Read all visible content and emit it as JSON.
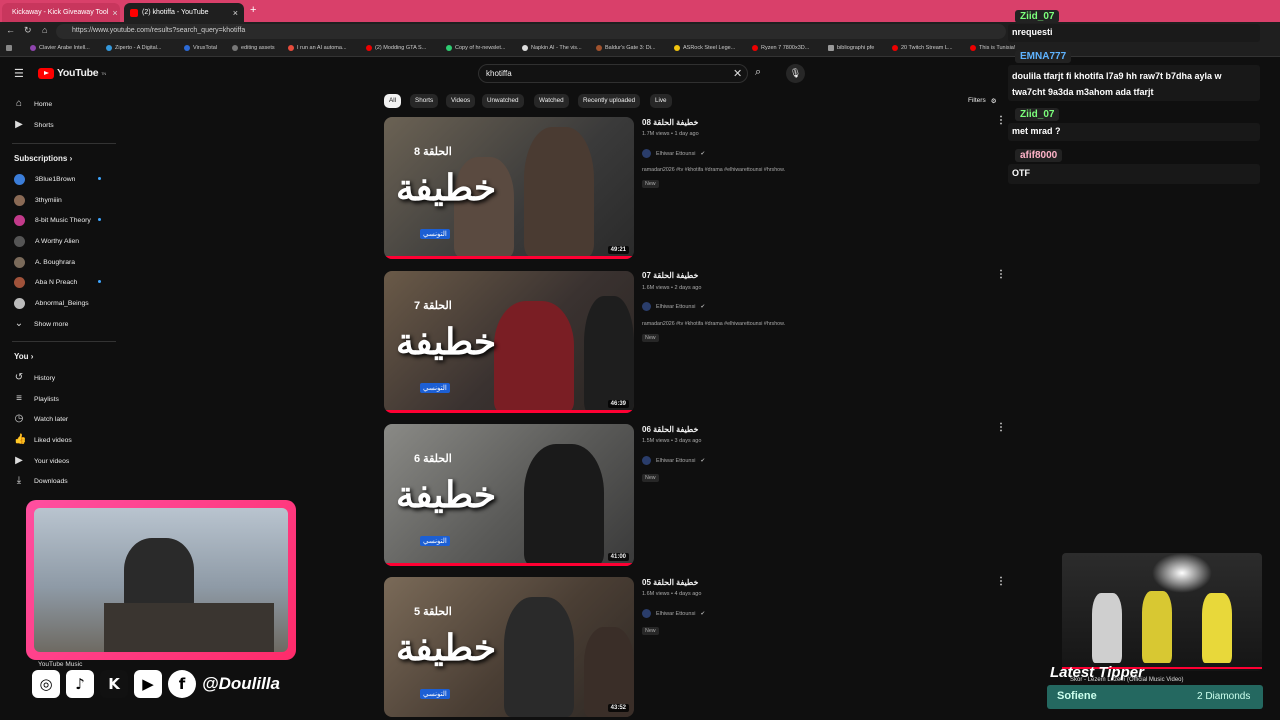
{
  "browser": {
    "tabs": [
      {
        "title": "Kickaway - Kick Giveaway Tool",
        "color": "#2ecc40"
      },
      {
        "title": "(2) khotiffa - YouTube",
        "color": "#ff0000"
      }
    ],
    "url": "https://www.youtube.com/results?search_query=khotiffa",
    "bookmarks": [
      "Clavier Arabe Intell...",
      "Ziperto - A Digital...",
      "VirusTotal",
      "editing assets",
      "I run an AI automa...",
      "(2) Modding GTA S...",
      "Copy of hr-newslet...",
      "Napkin AI - The vis...",
      "Baldur's Gate 3: Di...",
      "ASRock Steel Lege...",
      "Ryzen 7 7800x3D...",
      "bibliographi pfe",
      "20 Twitch Stream L...",
      "This is Tunisia!"
    ]
  },
  "youtube": {
    "logo_text": "YouTube",
    "logo_sup": "TN",
    "search_query": "khotiffa",
    "sidebar": {
      "top": [
        {
          "label": "Home",
          "icon": "home-icon"
        },
        {
          "label": "Shorts",
          "icon": "shorts-icon"
        }
      ],
      "subscriptions_title": "Subscriptions",
      "subscriptions": [
        {
          "label": "3Blue1Brown",
          "color": "#3b7dd8",
          "live": true
        },
        {
          "label": "3thymiiin",
          "color": "#8a6a55",
          "live": false
        },
        {
          "label": "8-bit Music Theory",
          "color": "#c23a8a",
          "live": true
        },
        {
          "label": "A Worthy Alien",
          "color": "#555",
          "live": false
        },
        {
          "label": "A. Boughrara",
          "color": "#7a6a5a",
          "live": false
        },
        {
          "label": "Aba N Preach",
          "color": "#a0523a",
          "live": true
        },
        {
          "label": "Abnormal_Beings",
          "color": "#bbbbbb",
          "live": false
        }
      ],
      "show_more": "Show more",
      "you_title": "You",
      "you": [
        {
          "label": "History",
          "icon": "history-icon"
        },
        {
          "label": "Playlists",
          "icon": "playlists-icon"
        },
        {
          "label": "Watch later",
          "icon": "watch-later-icon"
        },
        {
          "label": "Liked videos",
          "icon": "like-icon"
        },
        {
          "label": "Your videos",
          "icon": "your-videos-icon"
        },
        {
          "label": "Downloads",
          "icon": "download-icon"
        }
      ],
      "youtube_music": "YouTube Music"
    },
    "chips": [
      "All",
      "Shorts",
      "Videos",
      "Unwatched",
      "Watched",
      "Recently uploaded",
      "Live"
    ],
    "filters": "Filters",
    "results": [
      {
        "title": "خطيفة الحلقة 08",
        "views": "1.7M views",
        "age": "1 day ago",
        "channel": "Elhiwar Ettounsi",
        "desc": "ramadan2026 #tv #khotifa #drama #elhiwarettounsi #hrshow.",
        "badge": "New",
        "duration": "49:21",
        "ep_label": "الحلقة 8",
        "logo": "خطيفة",
        "tag": "التونسي"
      },
      {
        "title": "خطيفة الحلقة 07",
        "views": "1.6M views",
        "age": "2 days ago",
        "channel": "Elhiwar Ettounsi",
        "desc": "ramadan2026 #tv #khotifa #drama #elhiwarettounsi #hrshow.",
        "badge": "New",
        "duration": "46:39",
        "ep_label": "الحلقة 7",
        "logo": "خطيفة",
        "tag": "التونسي"
      },
      {
        "title": "خطيفة الحلقة 06",
        "views": "1.5M views",
        "age": "3 days ago",
        "channel": "Elhiwar Ettounsi",
        "desc": "",
        "badge": "New",
        "duration": "41:00",
        "ep_label": "الحلقة 6",
        "logo": "خطيفة",
        "tag": "التونسي"
      },
      {
        "title": "خطيفة الحلقة 05",
        "views": "1.6M views",
        "age": "4 days ago",
        "channel": "Elhiwar Ettounsi",
        "desc": "",
        "badge": "New",
        "duration": "43:52",
        "ep_label": "الحلقة 5",
        "logo": "خطيفة",
        "tag": "التونسي"
      }
    ]
  },
  "chat": {
    "messages": [
      {
        "user": "Ziid_07",
        "text": "nrequesti",
        "color": "#7cff7c"
      },
      {
        "user": "EMNA777",
        "text": "doulila tfarjt fi khotifa l7a9 hh raw7t b7dha ayla w twa7cht 9a3da m3ahom ada tfarjt",
        "color": "#5fb3ff"
      },
      {
        "user": "Ziid_07",
        "text": "met mrad ?",
        "color": "#7cff7c"
      },
      {
        "user": "afif8000",
        "text": "OTF",
        "color": "#ffb3c8"
      }
    ]
  },
  "overlay": {
    "handle": "@Doulilla",
    "latest_tipper_title": "Latest Tipper",
    "latest_tipper_name": "Sofiene",
    "latest_tipper_amount": "2 Diamonds",
    "now_playing": "Skor - Lezem Lezem (Official Music Video)"
  }
}
